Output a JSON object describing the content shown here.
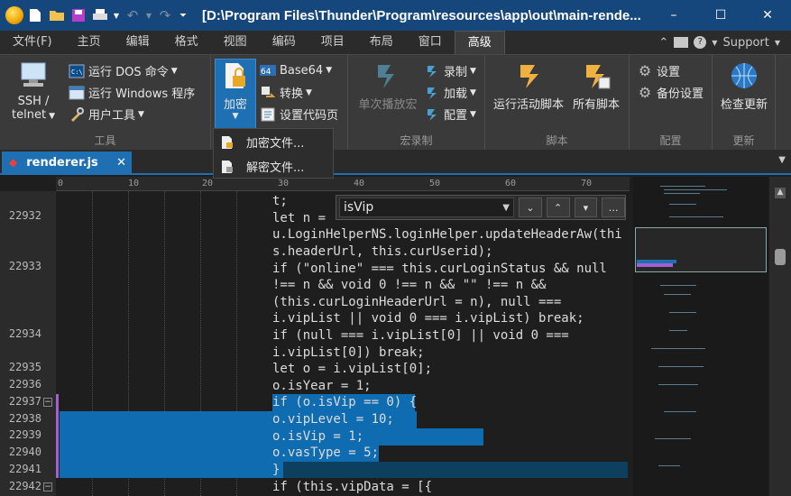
{
  "window": {
    "title": "[D:\\Program Files\\Thunder\\Program\\resources\\app\\out\\main-rende...",
    "controls": [
      "–",
      "☐",
      "✕"
    ]
  },
  "menu": {
    "tabs": [
      "文件(F)",
      "主页",
      "编辑",
      "格式",
      "视图",
      "编码",
      "项目",
      "布局",
      "窗口",
      "高级"
    ],
    "active": "高级",
    "support_label": "Support"
  },
  "ribbon": {
    "groups": {
      "tools": "工具",
      "macro": "宏录制",
      "script": "脚本",
      "config": "配置",
      "update": "更新"
    },
    "ssh_label": "SSH /\ntelnet",
    "run_dos": "运行 DOS 命令",
    "run_windows": "运行 Windows 程序",
    "user_tools": "用户工具",
    "encrypt": "加密",
    "base64": "Base64",
    "convert": "转换",
    "set_codepage": "设置代码页",
    "single_play_macro": "单次播放宏",
    "record": "录制",
    "load": "加载",
    "config_macro": "配置",
    "run_active_script": "运行活动脚本",
    "all_scripts": "所有脚本",
    "settings": "设置",
    "backup_settings": "备份设置",
    "check_update": "检查更新"
  },
  "encrypt_menu": {
    "items": [
      "加密文件...",
      "解密文件..."
    ]
  },
  "document": {
    "tab_label": "renderer.js",
    "close": "✕"
  },
  "ruler": {
    "marks": [
      "0",
      "10",
      "20",
      "30",
      "40",
      "50",
      "60",
      "70"
    ]
  },
  "gutter": {
    "line_numbers": [
      "22932",
      "22933",
      "22934",
      "22935",
      "22936",
      "22937",
      "22938",
      "22939",
      "22940",
      "22941",
      "22942"
    ]
  },
  "find": {
    "query": "isVip"
  },
  "code": {
    "lines": [
      "t;",
      "let n = ",
      "u.LoginHelperNS.loginHelper.updateHeaderAw(thi",
      "s.headerUrl, this.curUserid);",
      "if (\"online\" === this.curLoginStatus && null",
      "!== n && void 0 !== n && \"\" !== n &&",
      "(this.curLoginHeaderUrl = n), null ===",
      "i.vipList || void 0 === i.vipList) break;",
      "if (null === i.vipList[0] || void 0 ===",
      "i.vipList[0]) break;",
      "let o = i.vipList[0];",
      "o.isYear = 1;",
      "if (o.isVip == 0) {",
      "o.vipLevel = 10;",
      "o.isVip = 1;",
      "o.vasType = 5;",
      "}",
      "if (this.vipData = [{"
    ]
  }
}
